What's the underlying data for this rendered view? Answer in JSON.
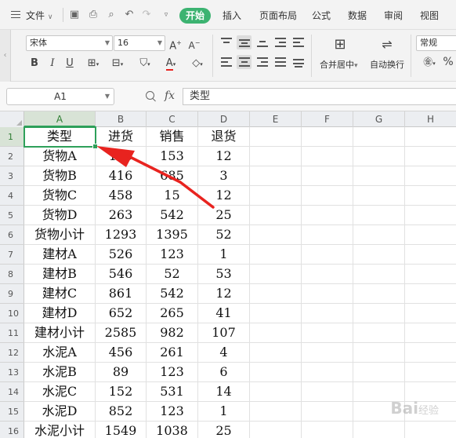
{
  "menu": {
    "file_label": "文件",
    "tabs": [
      "开始",
      "插入",
      "页面布局",
      "公式",
      "数据",
      "审阅",
      "视图"
    ]
  },
  "ribbon": {
    "font_name": "宋体",
    "font_size": "16",
    "number_format": "常规",
    "merge_label": "合并居中",
    "wrap_label": "自动换行"
  },
  "formula_bar": {
    "name_box": "A1",
    "fx_label": "fx",
    "content": "类型"
  },
  "grid": {
    "columns": [
      "A",
      "B",
      "C",
      "D",
      "E",
      "F",
      "G",
      "H"
    ],
    "rows": [
      {
        "n": "1",
        "cells": [
          "类型",
          "进货",
          "销售",
          "退货"
        ]
      },
      {
        "n": "2",
        "cells": [
          "货物A",
          "135",
          "153",
          "12"
        ]
      },
      {
        "n": "3",
        "cells": [
          "货物B",
          "416",
          "685",
          "3"
        ]
      },
      {
        "n": "4",
        "cells": [
          "货物C",
          "458",
          "15",
          "12"
        ]
      },
      {
        "n": "5",
        "cells": [
          "货物D",
          "263",
          "542",
          "25"
        ]
      },
      {
        "n": "6",
        "cells": [
          "货物小计",
          "1293",
          "1395",
          "52"
        ]
      },
      {
        "n": "7",
        "cells": [
          "建材A",
          "526",
          "123",
          "1"
        ]
      },
      {
        "n": "8",
        "cells": [
          "建材B",
          "546",
          "52",
          "53"
        ]
      },
      {
        "n": "9",
        "cells": [
          "建材C",
          "861",
          "542",
          "12"
        ]
      },
      {
        "n": "10",
        "cells": [
          "建材D",
          "652",
          "265",
          "41"
        ]
      },
      {
        "n": "11",
        "cells": [
          "建材小计",
          "2585",
          "982",
          "107"
        ]
      },
      {
        "n": "12",
        "cells": [
          "水泥A",
          "456",
          "261",
          "4"
        ]
      },
      {
        "n": "13",
        "cells": [
          "水泥B",
          "89",
          "123",
          "6"
        ]
      },
      {
        "n": "14",
        "cells": [
          "水泥C",
          "152",
          "531",
          "14"
        ]
      },
      {
        "n": "15",
        "cells": [
          "水泥D",
          "852",
          "123",
          "1"
        ]
      },
      {
        "n": "16",
        "cells": [
          "水泥小计",
          "1549",
          "1038",
          "25"
        ]
      }
    ],
    "selected_cell": "A1"
  },
  "colors": {
    "accent": "#2ea05a",
    "annotation_arrow": "#e8231f"
  },
  "watermark": {
    "text": "Bai",
    "suffix": "经验"
  }
}
